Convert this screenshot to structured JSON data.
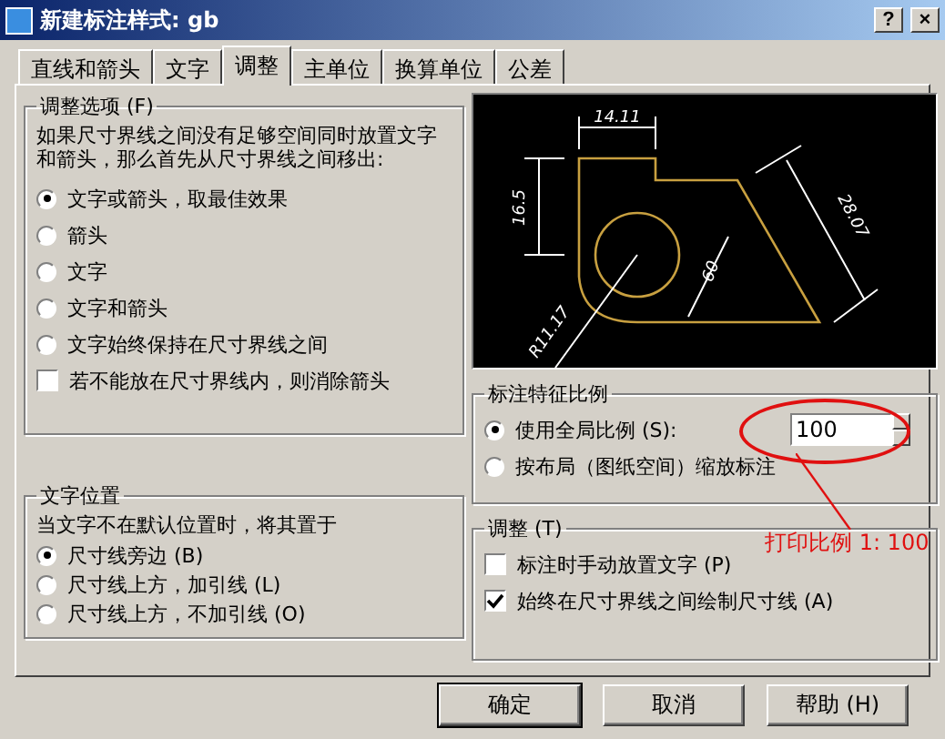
{
  "window": {
    "title": "新建标注样式: gb",
    "help": "?",
    "close": "×"
  },
  "tabs": [
    {
      "label": "直线和箭头",
      "selected": false
    },
    {
      "label": "文字",
      "selected": false
    },
    {
      "label": "调整",
      "selected": true
    },
    {
      "label": "主单位",
      "selected": false
    },
    {
      "label": "换算单位",
      "selected": false
    },
    {
      "label": "公差",
      "selected": false
    }
  ],
  "fit_options": {
    "title": "调整选项 (F)",
    "description": "如果尺寸界线之间没有足够空间同时放置文字和箭头，那么首先从尺寸界线之间移出:",
    "radios": [
      {
        "label": "文字或箭头，取最佳效果",
        "selected": true
      },
      {
        "label": "箭头",
        "selected": false
      },
      {
        "label": "文字",
        "selected": false
      },
      {
        "label": "文字和箭头",
        "selected": false
      },
      {
        "label": "文字始终保持在尺寸界线之间",
        "selected": false
      }
    ],
    "checkbox": {
      "label": "若不能放在尺寸界线内，则消除箭头",
      "checked": false
    }
  },
  "text_placement": {
    "title": "文字位置",
    "description": "当文字不在默认位置时，将其置于",
    "radios": [
      {
        "label": "尺寸线旁边 (B)",
        "selected": true
      },
      {
        "label": "尺寸线上方，加引线 (L)",
        "selected": false
      },
      {
        "label": "尺寸线上方，不加引线 (O)",
        "selected": false
      }
    ]
  },
  "preview": {
    "labels": [
      "14.11",
      "16.5",
      "28.07",
      "R11.17",
      "60"
    ]
  },
  "scale": {
    "title": "标注特征比例",
    "radios": [
      {
        "label": "使用全局比例 (S):",
        "selected": true
      },
      {
        "label": "按布局（图纸空间）缩放标注",
        "selected": false
      }
    ],
    "value": "100"
  },
  "annotation": {
    "text": "打印比例 1: 100"
  },
  "fine_tuning": {
    "title": "调整 (T)",
    "checkboxes": [
      {
        "label": "标注时手动放置文字 (P)",
        "checked": false
      },
      {
        "label": "始终在尺寸界线之间绘制尺寸线 (A)",
        "checked": true
      }
    ]
  },
  "buttons": [
    "确定",
    "取消",
    "帮助 (H)"
  ]
}
